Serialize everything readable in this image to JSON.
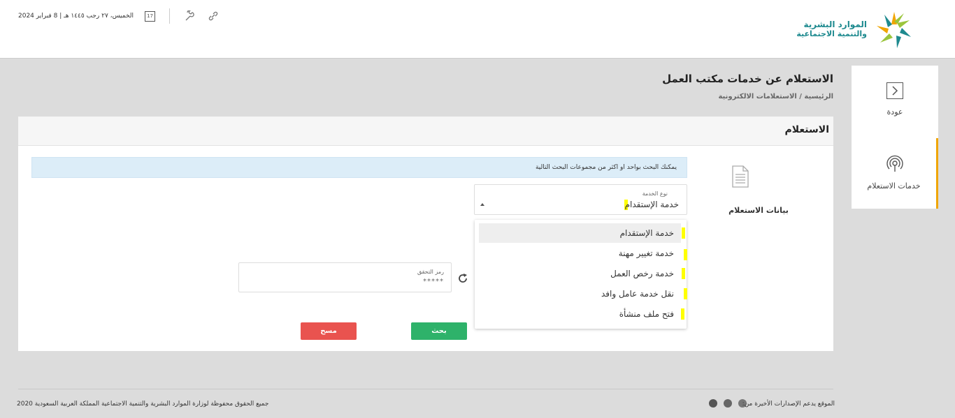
{
  "header": {
    "logo": {
      "line1": "الموارد البشرية",
      "line2": "والتنمية الاجتماعية"
    },
    "date": "الخميس، ٢٧ رجب ١٤٤٥ هـ | 8 فبراير 2024",
    "calendar_day": "17",
    "icons": [
      "calendar-icon",
      "wrench-icon",
      "link-icon"
    ]
  },
  "sidebar": {
    "back_label": "عودة",
    "services_label": "خدمات الاستعلام",
    "accent": "#f0a500"
  },
  "page": {
    "title": "الاستعلام عن خدمات مكتب العمل",
    "breadcrumb": "الرئيسية / الاستعلامات الالكترونية"
  },
  "card": {
    "title": "الاستعلام",
    "section_label": "بيانات الاستعلام",
    "info_text": "يمكنك البحث بواحد او اكثر من مجموعات البحث التالية",
    "service_type": {
      "label": "نوع الخدمة",
      "value": "خدمة الإستقدام",
      "options": [
        "خدمة الإستقدام",
        "خدمة تغيير مهنة",
        "خدمة رخص العمل",
        "نقل خدمة عامل وافد",
        "فتح ملف منشأة"
      ]
    },
    "captcha": {
      "label": "رمز التحقق",
      "value": "*****"
    },
    "search_button": "بحث",
    "clear_button": "مسح",
    "colors": {
      "search": "#2eb26a",
      "clear": "#e9534f",
      "info_bg": "#dcedf8"
    }
  },
  "footer": {
    "copyright": "جميع الحقوق محفوظة لوزارة الموارد البشرية والتنمية الاجتماعية المملكة العربية السعودية 2020",
    "browsers_text": "الموقع يدعم الإصدارات الأخيرة من:",
    "browser_icons": [
      "chrome-icon",
      "firefox-icon",
      "edge-icon"
    ]
  }
}
